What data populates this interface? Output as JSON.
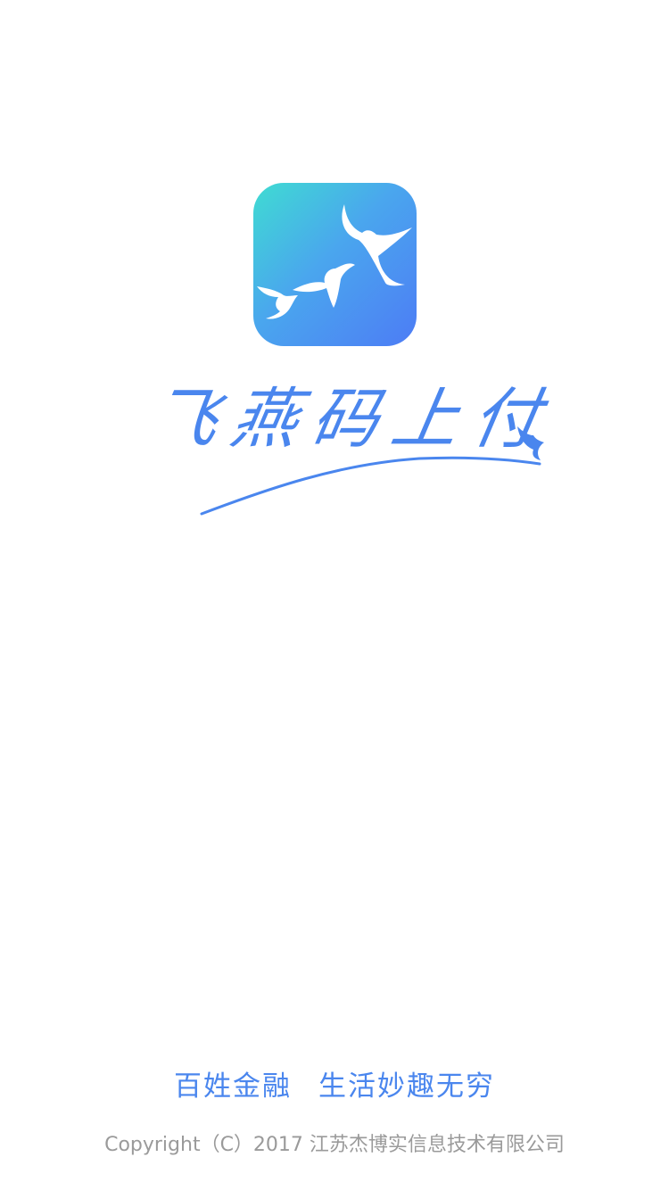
{
  "splash": {
    "brand_name": "飞燕码上付",
    "slogan_left": "百姓金融",
    "slogan_right": "生活妙趣无穷",
    "copyright": "Copyright（C）2017 江苏杰博实信息技术有限公司"
  },
  "icons": {
    "app_icon": "swallows-app-icon",
    "swallow_mark": "swallow-icon"
  },
  "colors": {
    "brand_blue": "#4a86ee",
    "icon_gradient_start": "#3fdcd2",
    "icon_gradient_end": "#4d7cf5",
    "copyright_gray": "#9a9a9a"
  }
}
